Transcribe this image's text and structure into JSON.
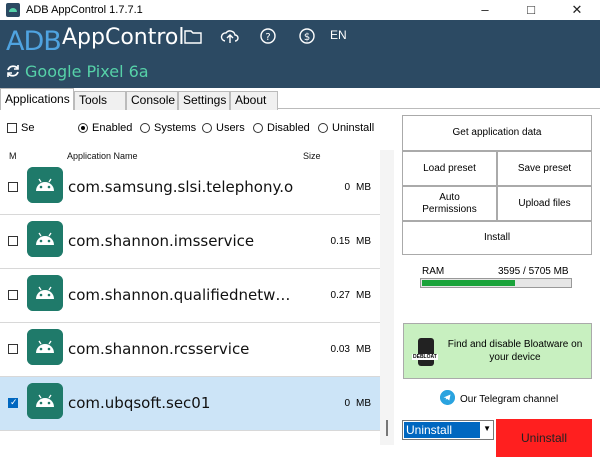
{
  "window": {
    "title": "ADB AppControl 1.7.7.1",
    "controls": [
      "minimize-icon",
      "maximize-icon",
      "close-icon"
    ]
  },
  "header": {
    "logo_adb": "ADB",
    "logo_app": "AppControl",
    "icons": [
      "folder-icon",
      "cloud-upload-icon",
      "help-icon",
      "donate-icon"
    ],
    "language": "EN",
    "device": "Google Pixel 6a",
    "accent_color": "#2c4a63",
    "device_color": "#56d1a8"
  },
  "tabs": [
    {
      "label": "Applications",
      "active": true
    },
    {
      "label": "Tools",
      "active": false
    },
    {
      "label": "Console",
      "active": false
    },
    {
      "label": "Settings",
      "active": false
    },
    {
      "label": "About",
      "active": false
    }
  ],
  "filters": {
    "select_label": "Se",
    "options": [
      {
        "label": "Enabled",
        "selected": true
      },
      {
        "label": "Systems",
        "selected": false
      },
      {
        "label": "Users",
        "selected": false
      },
      {
        "label": "Disabled",
        "selected": false
      },
      {
        "label": "Uninstall",
        "selected": false
      }
    ]
  },
  "columns": {
    "mark": "M",
    "name": "Application Name",
    "size": "Size"
  },
  "apps": [
    {
      "name": "com.samsung.slsi.telephony.oemril",
      "size": "0",
      "unit": "MB",
      "checked": false,
      "selected": false
    },
    {
      "name": "com.shannon.imsservice",
      "size": "0.15",
      "unit": "MB",
      "checked": false,
      "selected": false
    },
    {
      "name": "com.shannon.qualifiednetworksservice",
      "size": "0.27",
      "unit": "MB",
      "checked": false,
      "selected": false
    },
    {
      "name": "com.shannon.rcsservice",
      "size": "0.03",
      "unit": "MB",
      "checked": false,
      "selected": false
    },
    {
      "name": "com.ubqsoft.sec01",
      "size": "0",
      "unit": "MB",
      "checked": true,
      "selected": true
    }
  ],
  "actions": {
    "get_data": "Get application data",
    "load_preset": "Load preset",
    "save_preset": "Save preset",
    "auto_permissions": "Auto\nPermissions",
    "upload_files": "Upload files",
    "install": "Install"
  },
  "ram": {
    "label": "RAM",
    "value": "3595 / 5705 MB",
    "fraction": 0.63,
    "bar_color": "#1aa33a"
  },
  "debloat": {
    "text": "Find and disable Bloatware on your device",
    "badge": "DEBLOAT"
  },
  "telegram": {
    "label": "Our Telegram channel"
  },
  "bottom": {
    "select_value": "Uninstall",
    "button": "Uninstall",
    "button_color": "#ff1f1f"
  }
}
